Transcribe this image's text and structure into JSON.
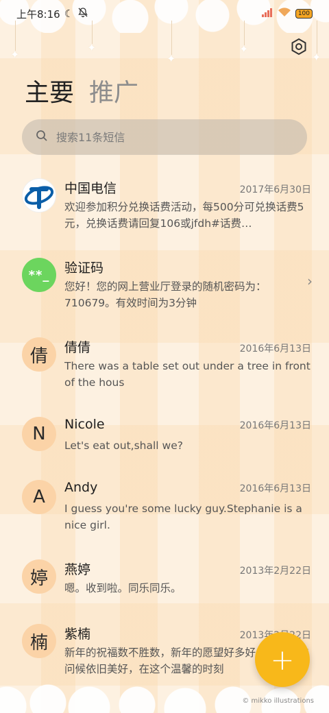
{
  "status_bar": {
    "time": "上午8:16",
    "battery": "100"
  },
  "tabs": [
    {
      "label": "主要",
      "active": true
    },
    {
      "label": "推广",
      "active": false
    }
  ],
  "search": {
    "placeholder": "搜索11条短信"
  },
  "conversations": [
    {
      "avatar_type": "telecom-logo",
      "avatar_text": "",
      "name": "中国电信",
      "date": "2017年6月30日",
      "preview": "欢迎参加积分兑换话费活动，每500分可兑换话费5元，兑换话费请回复106或jfdh#话费…"
    },
    {
      "avatar_type": "verification",
      "avatar_text": "**_",
      "name": "验证码",
      "date": "",
      "preview": "您好！您的网上营业厅登录的随机密码为：710679。有效时间为3分钟"
    },
    {
      "avatar_type": "letter",
      "avatar_text": "倩",
      "name": "倩倩",
      "date": "2016年6月13日",
      "preview": "There was a table set out under a tree in front of the hous"
    },
    {
      "avatar_type": "letter",
      "avatar_text": "N",
      "name": "Nicole",
      "date": "2016年6月13日",
      "preview": "Let's eat out,shall we?"
    },
    {
      "avatar_type": "letter",
      "avatar_text": "A",
      "name": "Andy",
      "date": "2016年6月13日",
      "preview": "I guess you're some lucky guy.Stephanie is a nice girl."
    },
    {
      "avatar_type": "letter",
      "avatar_text": "婷",
      "name": "燕婷",
      "date": "2013年2月22日",
      "preview": "嗯。收到啦。同乐同乐。"
    },
    {
      "avatar_type": "letter",
      "avatar_text": "楠",
      "name": "紫楠",
      "date": "2013年2月22日",
      "preview": "新年的祝福数不胜数，新年的愿望好多好多，新年的问候依旧美好，在这个温馨的时刻"
    }
  ],
  "fab": {
    "label": "+"
  },
  "credit": "© mikko illustrations",
  "colors": {
    "accent": "#f8b81a",
    "avatar_bg": "#fbd3a7",
    "verify_green": "#6cd55e",
    "telecom_blue": "#0a5ea8"
  }
}
